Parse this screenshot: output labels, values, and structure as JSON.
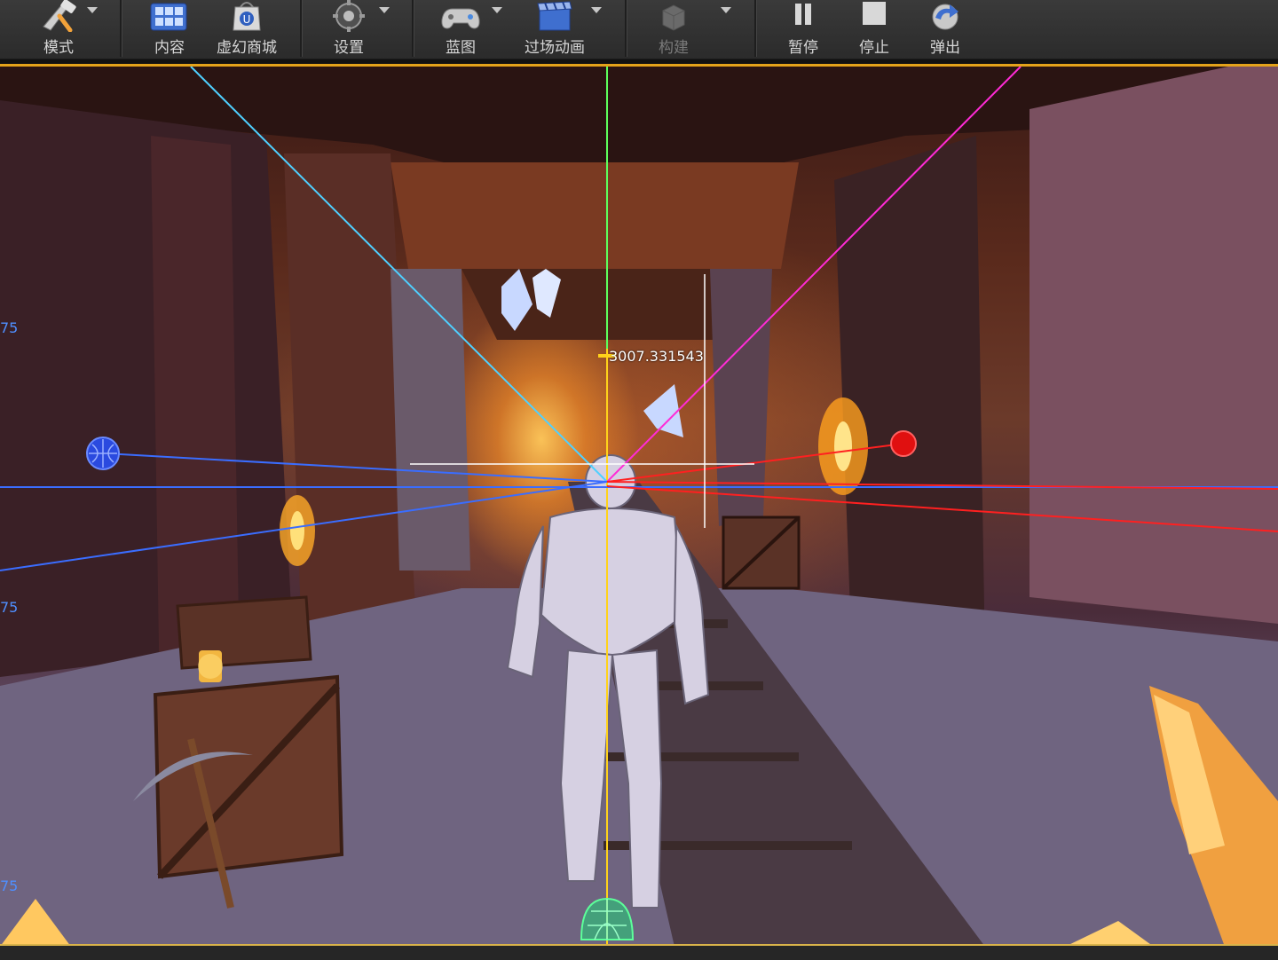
{
  "toolbar": {
    "buttons": [
      {
        "label": "模式",
        "icon": "modes-icon",
        "dropdown": true,
        "enabled": true
      },
      {
        "label": "内容",
        "icon": "content-browser-icon",
        "dropdown": false,
        "enabled": true
      },
      {
        "label": "虚幻商城",
        "icon": "marketplace-icon",
        "dropdown": false,
        "enabled": true
      },
      {
        "label": "设置",
        "icon": "settings-icon",
        "dropdown": true,
        "enabled": true
      },
      {
        "label": "蓝图",
        "icon": "blueprint-icon",
        "dropdown": true,
        "enabled": true
      },
      {
        "label": "过场动画",
        "icon": "cinematics-icon",
        "dropdown": true,
        "enabled": true
      },
      {
        "label": "构建",
        "icon": "build-icon",
        "dropdown": true,
        "enabled": false
      },
      {
        "label": "暂停",
        "icon": "pause-icon",
        "dropdown": false,
        "enabled": true
      },
      {
        "label": "停止",
        "icon": "stop-icon",
        "dropdown": false,
        "enabled": true
      },
      {
        "label": "弹出",
        "icon": "eject-icon",
        "dropdown": false,
        "enabled": true
      }
    ]
  },
  "viewport": {
    "distance_readout": "3007.331543",
    "left_edge_labels": [
      "75",
      "75",
      "75"
    ],
    "colors": {
      "accent_border": "#e3a21a",
      "debug_green": "#5cff5c",
      "debug_yellow": "#ffd21a",
      "debug_blue": "#3a6dff",
      "debug_red": "#ff2020",
      "debug_cyan": "#4fd0ff",
      "debug_magenta": "#ff2bd6",
      "debug_white": "#ffffff"
    }
  }
}
